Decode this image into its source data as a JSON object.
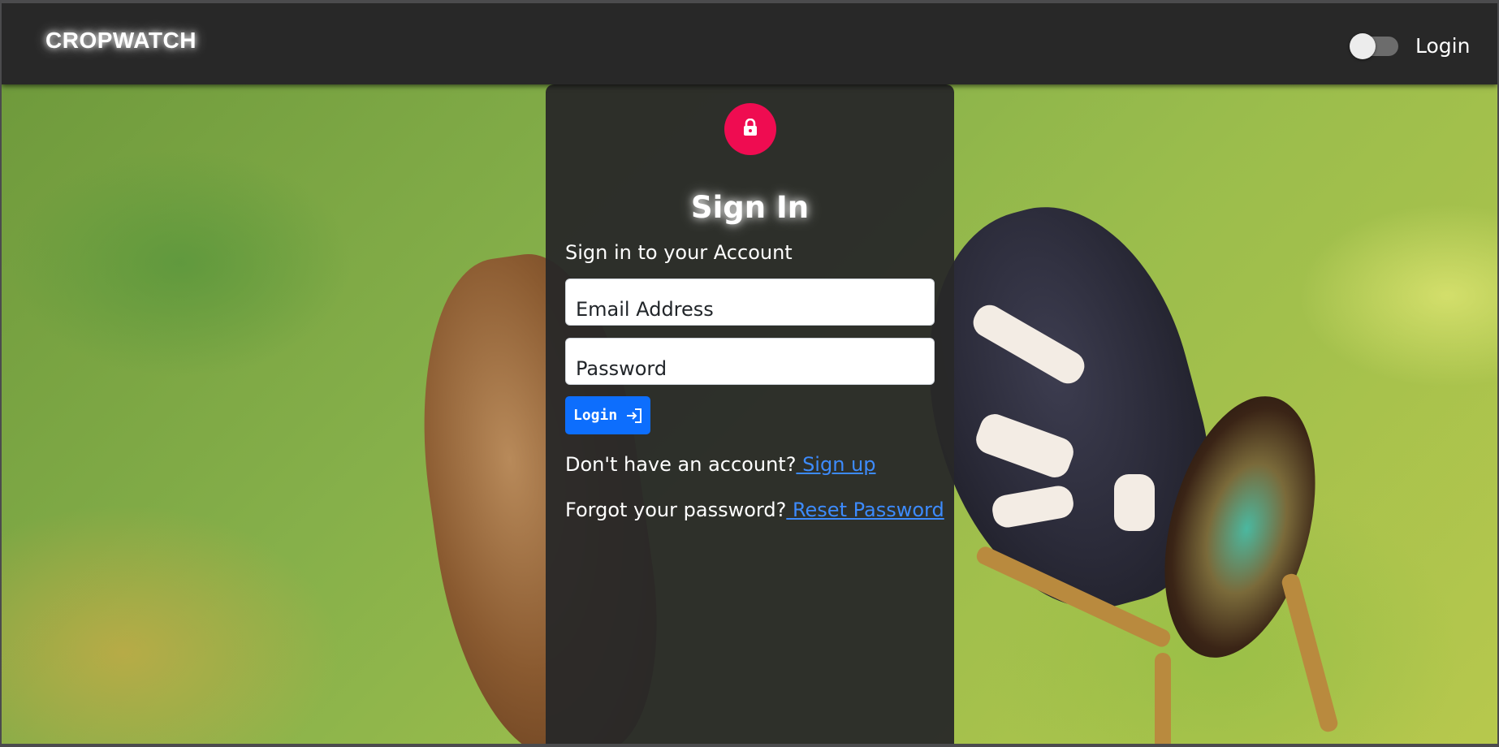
{
  "navbar": {
    "brand": "CROPWATCH",
    "theme_toggle": {
      "checked": false
    },
    "login_link": "Login"
  },
  "signin": {
    "title": "Sign In",
    "subtitle": "Sign in to your Account",
    "email_placeholder": "Email Address",
    "password_placeholder": "Password",
    "login_button": "Login",
    "no_account_text": "Don't have an account?",
    "signup_link": " Sign up",
    "forgot_text": "Forgot your password?",
    "reset_link": " Reset Password"
  },
  "colors": {
    "navbar_bg": "#282828",
    "card_bg": "#282828",
    "lock_avatar": "#ef0c51",
    "primary_button": "#0d6efd",
    "link": "#3d8bfd"
  },
  "icons": {
    "lock": "lock-icon",
    "login_arrow": "login-arrow-icon"
  }
}
